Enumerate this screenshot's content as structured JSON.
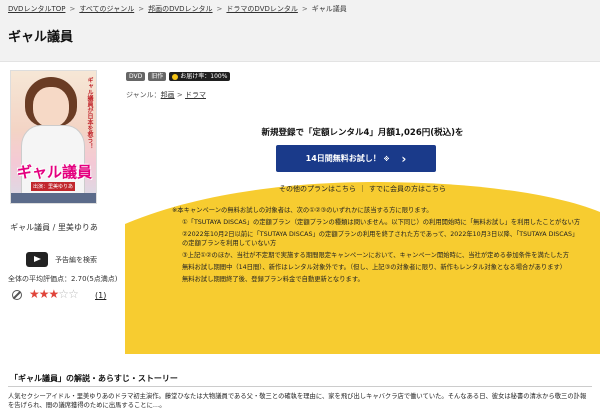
{
  "breadcrumb": {
    "items": [
      "DVDレンタルTOP",
      "すべてのジャンル",
      "邦画のDVDレンタル",
      "ドラマのDVDレンタル"
    ],
    "current": "ギャル議員",
    "separator": ">"
  },
  "page_title": "ギャル議員",
  "cover": {
    "tagline": "ギャル議員が日本を救う！",
    "title": "ギャル議員",
    "cast": "出演：里美ゆりあ"
  },
  "cover_caption": "ギャル議員 / 里美ゆりあ",
  "preview_label": "予告編を検索",
  "rating": {
    "text": "全体の平均評価点：",
    "value": "2.70",
    "count_note": "(5点満点)",
    "stars_filled": 3,
    "stars_total": 5,
    "review_count": "(1)"
  },
  "badges": {
    "dvd": "DVD",
    "old": "旧作",
    "delivery": "お届け率：100%"
  },
  "genre": {
    "label": "ジャンル：",
    "items": [
      "邦画",
      "ドラマ"
    ],
    "sep": ">"
  },
  "promo": {
    "headline": "新規登録で「定額レンタル4」月額1,026円(税込)を",
    "cta_label": "14日間無料お試し！",
    "cta_suffix": "※",
    "other_plan": "その他のプランはこちら",
    "member_link": "すでに会員の方はこちら",
    "link_sep": "｜"
  },
  "notes": {
    "intro": "※本キャンペーンの無料お試しの対象者は、次の①②③のいずれかに該当する方に限ります。",
    "n1": "①「TSUTAYA DISCAS」の定額プラン（定額プランの種類は問いません。以下同じ）の利用開始時に「無料お試し」を利用したことがない方",
    "n2": "②2022年10月2日以前に「TSUTAYA DISCAS」の定額プランの利用を終了された方であって、2022年10月3日以降、「TSUTAYA DISCAS」の定額プランを利用していない方",
    "n3": "③上記①②のほか、当社が不定期で実施する期間限定キャンペーンにおいて、キャンペーン開始時に、当社が定める参加条件を満たした方",
    "n4": "無料お試し期間中（14日間）、新作はレンタル対象外です。（但し、上記③の対象者に限り、新作もレンタル対象となる場合があります）",
    "n5": "無料お試し期間終了後、登録プラン料金で自動更新となります。"
  },
  "section": {
    "title": "「ギャル議員」の解説・あらすじ・ストーリー",
    "synopsis": "人気セクシーアイドル・里美ゆりあのドラマ初主演作。藤堂ひなたは大物議員である父・敬三との確執を理由に、家を飛び出しキャバクラ店で働いていた。そんなある日、彼女は秘書の清水から敬三の訃報を告げられ、間の議席獲得のために出馬することに…。"
  },
  "colors": {
    "accent_yellow": "#f7cc30",
    "cta_blue": "#1a3a8a",
    "star_red": "#e0443a"
  }
}
